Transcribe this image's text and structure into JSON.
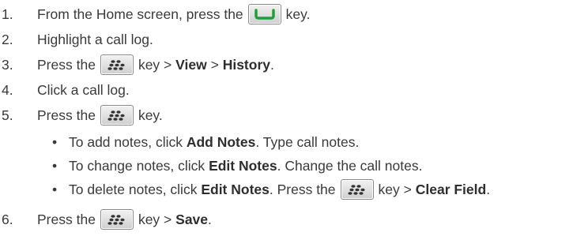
{
  "steps": [
    {
      "num": "1.",
      "before": "From the Home screen, press the",
      "after": "key."
    },
    {
      "num": "2.",
      "text": "Highlight a call log."
    },
    {
      "num": "3.",
      "before": "Press the",
      "after": "key >",
      "bold1": "View",
      "sep": ">",
      "bold2": "History",
      "end": "."
    },
    {
      "num": "4.",
      "text": "Click a call log."
    },
    {
      "num": "5.",
      "before": "Press the",
      "after": "key."
    },
    {
      "num": "6.",
      "before": "Press the",
      "after": "key >",
      "bold1": "Save",
      "end": "."
    }
  ],
  "substeps": [
    {
      "bullet": "•",
      "pre": "To add notes, click",
      "bold": "Add Notes",
      "post": ". Type call notes."
    },
    {
      "bullet": "•",
      "pre": "To change notes, click",
      "bold": "Edit Notes",
      "post": ". Change the call notes."
    },
    {
      "bullet": "•",
      "pre": "To delete notes, click",
      "bold": "Edit Notes",
      "mid": ". Press the",
      "post": "key >",
      "bold2": "Clear Field",
      "end": "."
    }
  ],
  "icons": {
    "send_key": "phone-send-key-icon",
    "menu_key": "blackberry-menu-key-icon"
  },
  "colors": {
    "send_key_green": "#1f9e3a",
    "menu_key_dark": "#333333"
  }
}
